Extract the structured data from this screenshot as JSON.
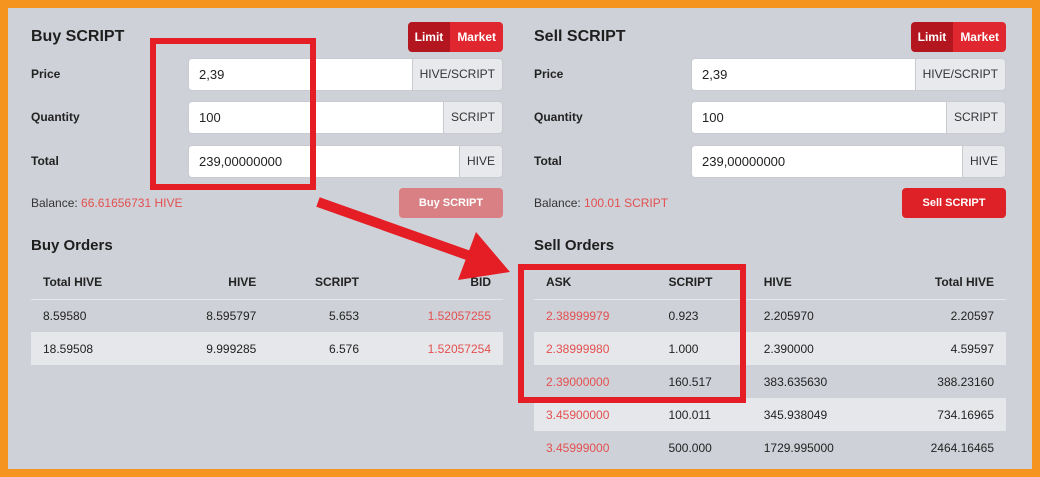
{
  "buy": {
    "title": "Buy SCRIPT",
    "toggle": {
      "limit": "Limit",
      "market": "Market"
    },
    "price": {
      "label": "Price",
      "value": "2,39",
      "unit": "HIVE/SCRIPT"
    },
    "quantity": {
      "label": "Quantity",
      "value": "100",
      "unit": "SCRIPT"
    },
    "total": {
      "label": "Total",
      "value": "239,00000000",
      "unit": "HIVE"
    },
    "balance_label": "Balance:",
    "balance_value": "66.61656731 HIVE",
    "button": "Buy SCRIPT",
    "orders_title": "Buy Orders",
    "columns": [
      "Total HIVE",
      "HIVE",
      "SCRIPT",
      "BID"
    ],
    "rows": [
      [
        "8.59580",
        "8.595797",
        "5.653",
        "1.52057255"
      ],
      [
        "18.59508",
        "9.999285",
        "6.576",
        "1.52057254"
      ]
    ]
  },
  "sell": {
    "title": "Sell SCRIPT",
    "toggle": {
      "limit": "Limit",
      "market": "Market"
    },
    "price": {
      "label": "Price",
      "value": "2,39",
      "unit": "HIVE/SCRIPT"
    },
    "quantity": {
      "label": "Quantity",
      "value": "100",
      "unit": "SCRIPT"
    },
    "total": {
      "label": "Total",
      "value": "239,00000000",
      "unit": "HIVE"
    },
    "balance_label": "Balance:",
    "balance_value": "100.01 SCRIPT",
    "button": "Sell SCRIPT",
    "orders_title": "Sell Orders",
    "columns": [
      "ASK",
      "SCRIPT",
      "HIVE",
      "Total HIVE"
    ],
    "rows": [
      [
        "2.38999979",
        "0.923",
        "2.205970",
        "2.20597"
      ],
      [
        "2.38999980",
        "1.000",
        "2.390000",
        "4.59597"
      ],
      [
        "2.39000000",
        "160.517",
        "383.635630",
        "388.23160"
      ],
      [
        "3.45900000",
        "100.011",
        "345.938049",
        "734.16965"
      ],
      [
        "3.45999000",
        "500.000",
        "1729.995000",
        "2464.16465"
      ]
    ]
  },
  "colors": {
    "frame": "#f5941f",
    "accent": "#dd2126",
    "price_red": "#e35050",
    "annotation": "#e51e25"
  }
}
